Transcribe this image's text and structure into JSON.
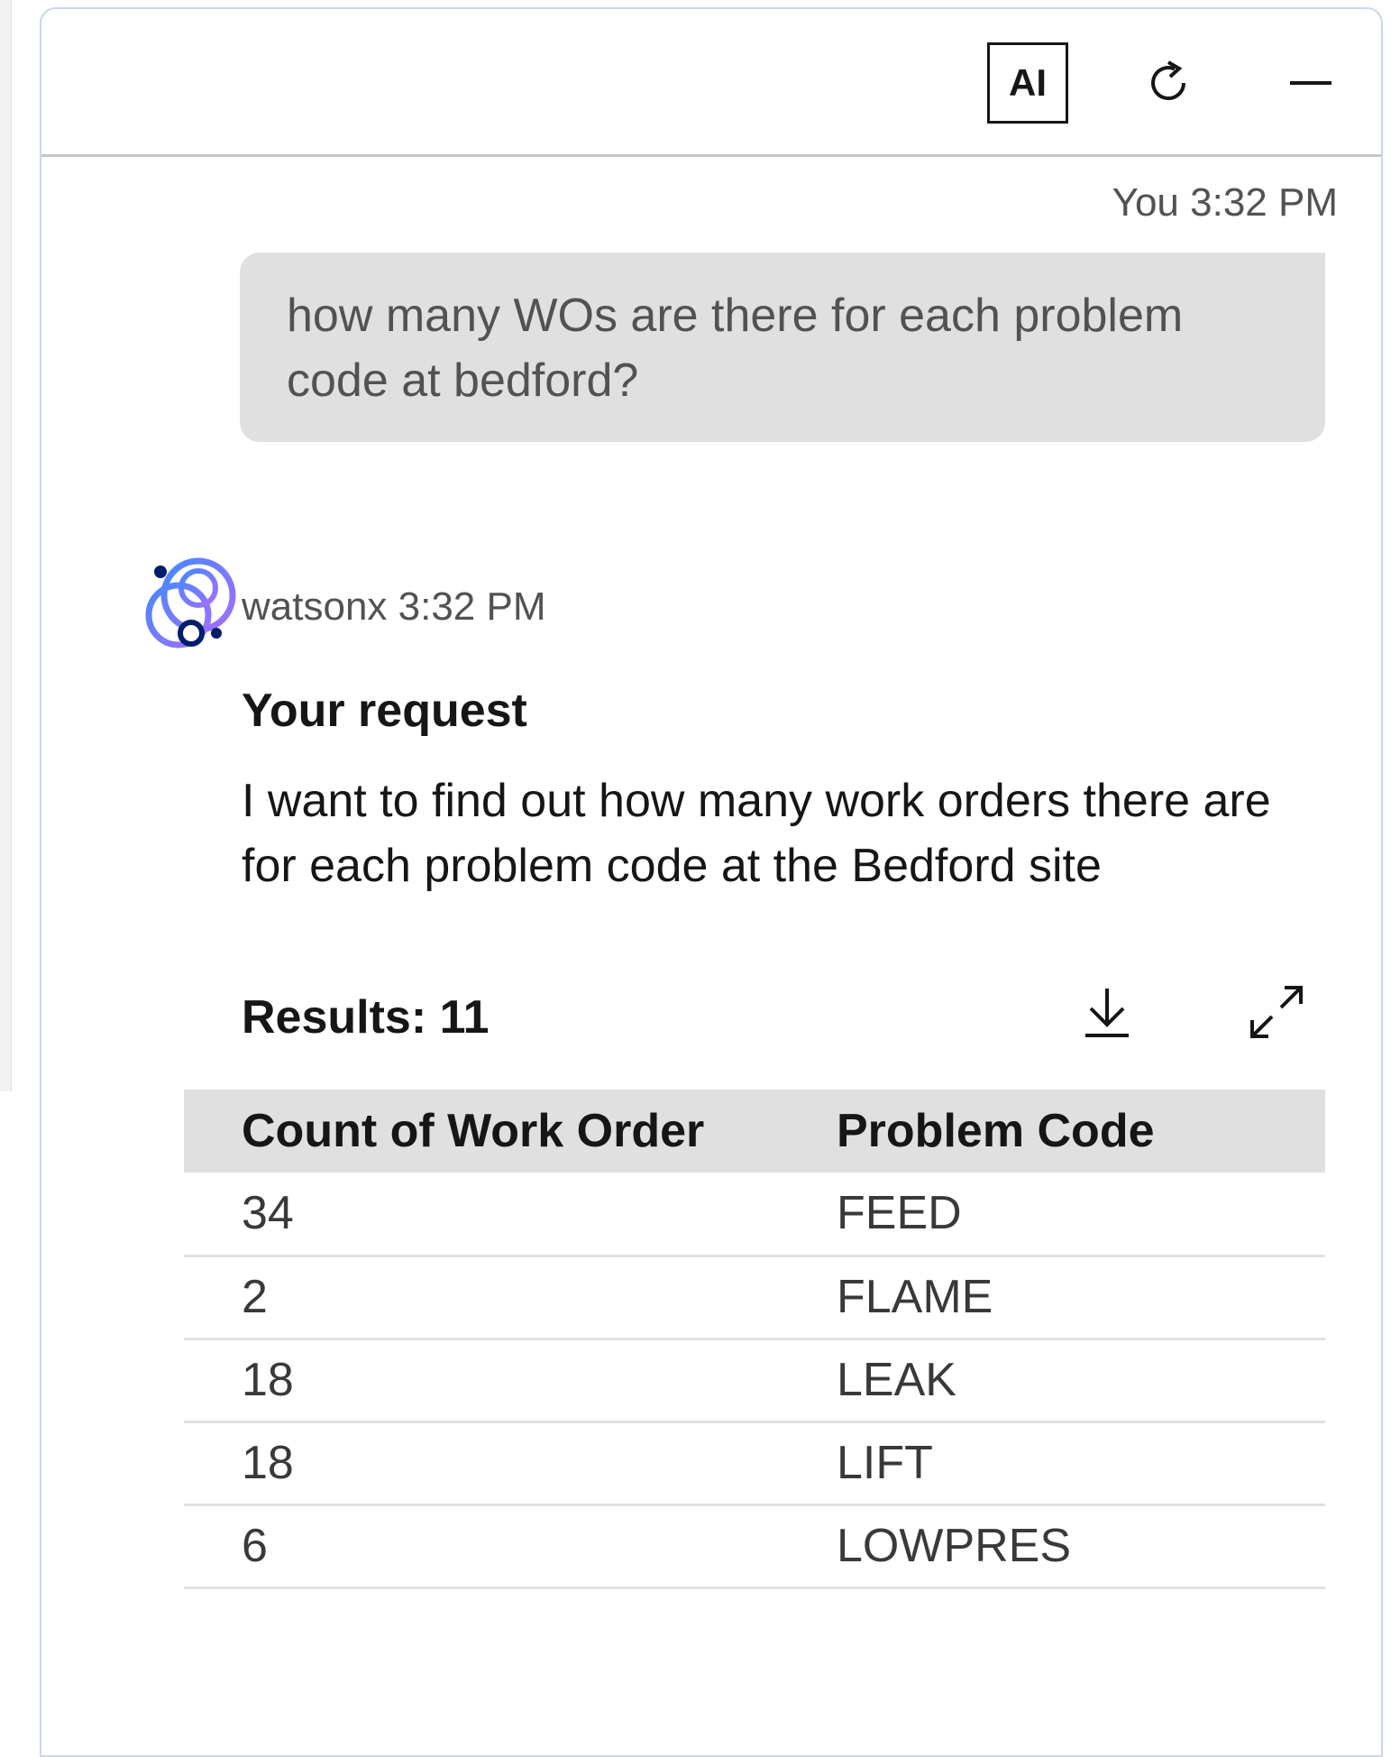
{
  "header": {
    "ai_label": "AI",
    "icons": [
      "refresh-icon",
      "minimize-icon"
    ]
  },
  "user_message": {
    "meta": "You 3:32 PM",
    "text": "how many WOs are there for each problem code at bedford?"
  },
  "bot_message": {
    "meta": "watsonx 3:32 PM",
    "request_title": "Your request",
    "request_text": "I want to find out how many work orders there are for each problem code at the Bedford site",
    "results_label": "Results: 11",
    "icons": [
      "download-icon",
      "expand-icon"
    ],
    "table": {
      "columns": [
        "Count of Work Order",
        "Problem Code"
      ],
      "rows": [
        [
          "34",
          "FEED"
        ],
        [
          "2",
          "FLAME"
        ],
        [
          "18",
          "LEAK"
        ],
        [
          "18",
          "LIFT"
        ],
        [
          "6",
          "LOWPRES"
        ]
      ]
    }
  },
  "colors": {
    "panel_border": "#c9d6f2",
    "bubble_bg": "#e0e0e0",
    "text_primary": "#161616",
    "text_secondary": "#525252",
    "avatar_blue": "#4589ff",
    "avatar_purple": "#a56eff",
    "avatar_navy": "#001d6c"
  }
}
